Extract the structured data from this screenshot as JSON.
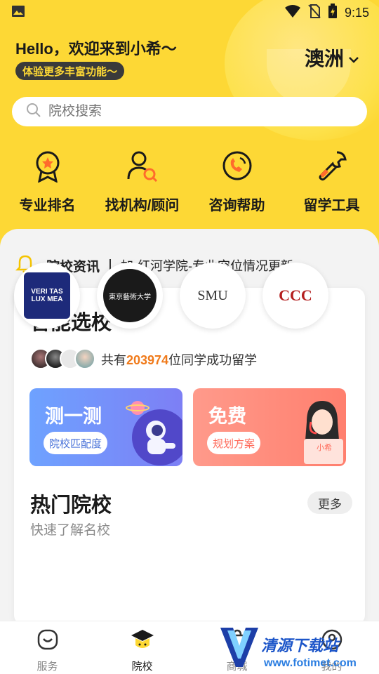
{
  "status_bar": {
    "time": "9:15"
  },
  "header": {
    "greeting": "Hello，欢迎来到小希～",
    "badge": "体验更多丰富功能～",
    "region": "澳洲"
  },
  "search": {
    "placeholder": "院校搜索"
  },
  "quick_actions": [
    {
      "label": "专业排名",
      "icon": "ranking-medal-icon"
    },
    {
      "label": "找机构/顾问",
      "icon": "find-consultant-icon"
    },
    {
      "label": "咨询帮助",
      "icon": "consult-phone-icon"
    },
    {
      "label": "留学工具",
      "icon": "tools-wrench-icon"
    }
  ],
  "news": {
    "title": "院校资讯",
    "headline": "加-红河学院-专业空位情况更新"
  },
  "smart_select": {
    "title": "智能选校",
    "students_prefix": "共有",
    "students_count": "203974",
    "students_suffix": "位同学成功留学",
    "promo_test": {
      "title": "测一测",
      "button": "院校匹配度"
    },
    "promo_free": {
      "title": "免费",
      "button": "规划方案",
      "sign": "小希"
    }
  },
  "hot_schools": {
    "title": "热门院校",
    "subtitle": "快速了解名校",
    "more": "更多",
    "schools": [
      {
        "label": "VERI TAS LUX MEA"
      },
      {
        "label": "東京藝術大学"
      },
      {
        "label": "SMU"
      },
      {
        "label": "CCC"
      }
    ]
  },
  "tabbar": {
    "tabs": [
      {
        "label": "服务",
        "icon": "service-face-icon",
        "active": false
      },
      {
        "label": "院校",
        "icon": "graduation-cap-icon",
        "active": true
      },
      {
        "label": "商城",
        "icon": "shop-bag-icon",
        "active": false
      },
      {
        "label": "我的",
        "icon": "profile-icon",
        "active": false
      }
    ]
  },
  "watermark": {
    "text": "清源下载站",
    "url": "www.fotimet.com"
  },
  "colors": {
    "brand_yellow": "#fdd835",
    "accent_orange": "#f07a1a",
    "dark": "#1a1a1a"
  }
}
